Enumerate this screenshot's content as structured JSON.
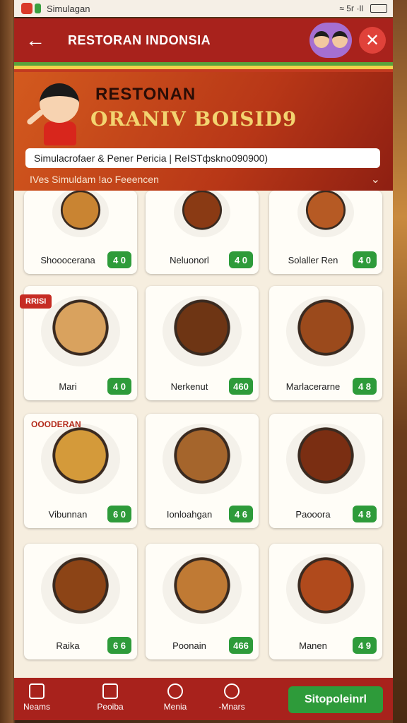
{
  "status_bar": {
    "title": "Simulagan",
    "signal": "≈ 5г ·ll"
  },
  "header": {
    "title": "RESTORAN INDONSIA"
  },
  "hero": {
    "title_line1": "RESTONAN",
    "title_line2": "ORANIV BOISID9",
    "search_value": "Simulacrofaer & Pener Pericia | ReISTфskno090900)",
    "subline": "IVes Simuldam !ao Feeencen"
  },
  "menu": [
    {
      "name": "Shooocerana",
      "price": "4 0",
      "dish_color": "#c98432"
    },
    {
      "name": "Neluonorl",
      "price": "4 0",
      "dish_color": "#8a3a14"
    },
    {
      "name": "Solaller Ren",
      "price": "4 0",
      "dish_color": "#b65a24"
    },
    {
      "name": "Mari",
      "price": "4 0",
      "dish_color": "#d9a25e",
      "badge": "RRISI"
    },
    {
      "name": "Nerkenut",
      "price": "460",
      "dish_color": "#6e3514"
    },
    {
      "name": "Marlacerarne",
      "price": "4 8",
      "dish_color": "#9b4a1c"
    },
    {
      "name": "Vibunnan",
      "price": "6 0",
      "dish_color": "#d49a3a",
      "label": "OOODERAN"
    },
    {
      "name": "Ionloahgan",
      "price": "4 6",
      "dish_color": "#a5652c"
    },
    {
      "name": "Paooora",
      "price": "4 8",
      "dish_color": "#7a2e12"
    },
    {
      "name": "Raika",
      "price": "6 6",
      "dish_color": "#8c4416"
    },
    {
      "name": "Poonain",
      "price": "466",
      "dish_color": "#c07a34"
    },
    {
      "name": "Manen",
      "price": "4 9",
      "dish_color": "#b04a1c"
    }
  ],
  "nav": {
    "items": [
      "Neams",
      "Peoiba",
      "Menia",
      "-Mnars"
    ],
    "cta": "Sitopoleinrl"
  },
  "colors": {
    "brand_red": "#a8221c",
    "accent_green": "#2e9b3a"
  }
}
